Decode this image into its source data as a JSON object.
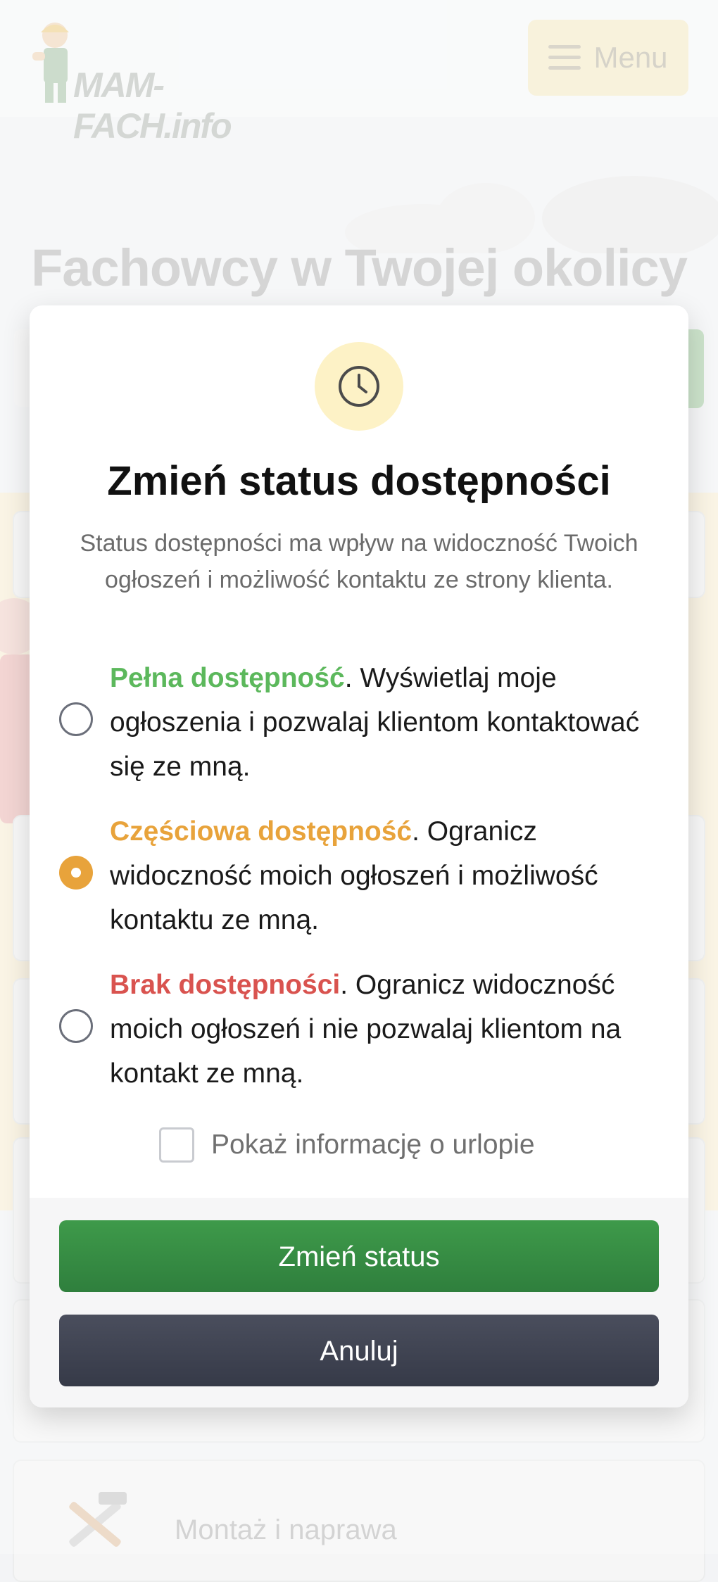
{
  "header": {
    "logo_text": "MAM-FACH.info",
    "menu_label": "Menu",
    "menu_icon": "hamburger-icon"
  },
  "hero": {
    "title": "Fachowcy w Twojej okolicy"
  },
  "background_category": {
    "label": "Montaż i naprawa",
    "icon": "tools-icon"
  },
  "modal": {
    "icon": "clock-icon",
    "title": "Zmień status dostępności",
    "description": "Status dostępności ma wpływ na widoczność Twoich ogłoszeń i możliwość kontaktu ze strony klienta.",
    "options": [
      {
        "highlight": "Pełna dostępność",
        "text": ". Wyświetlaj moje ogłoszenia i pozwalaj klientom kontaktować się ze mną.",
        "color": "#5cb85c",
        "selected": false
      },
      {
        "highlight": "Częściowa dostępność",
        "text": ". Ogranicz widoczność moich ogłoszeń i możliwość kontaktu ze mną.",
        "color": "#e8a33b",
        "selected": true
      },
      {
        "highlight": "Brak dostępności",
        "text": ". Ogranicz widoczność moich ogłoszeń i nie pozwalaj klientom na kontakt ze mną.",
        "color": "#d9534f",
        "selected": false
      }
    ],
    "vacation_label": "Pokaż informację o urlopie",
    "vacation_checked": false,
    "confirm_label": "Zmień status",
    "cancel_label": "Anuluj"
  },
  "colors": {
    "primary_button": "#2f8a3f",
    "secondary_button": "#3f4352",
    "accent_yellow": "#fdf2c6"
  }
}
